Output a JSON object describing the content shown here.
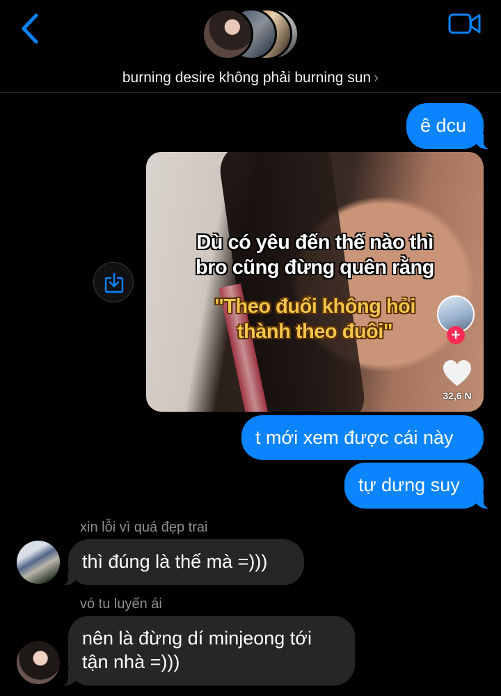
{
  "header": {
    "group_name": "burning desire không phải burning sun",
    "chevron": "›",
    "back_icon": "chevron-left-icon",
    "video_icon": "video-camera-icon",
    "accent_color": "#0a84ff"
  },
  "messages": {
    "out1": "ê dcu",
    "video": {
      "caption_line1": "Dù có yêu đến thế nào thì",
      "caption_line2": "bro cũng đừng quên rằng",
      "caption_quote1": "\"Theo đuổi không hỏi",
      "caption_quote2": "thành theo đuôi\"",
      "likes": "32,6 N",
      "plus": "+"
    },
    "out2": "t mới xem được cái này",
    "out3": "tự dưng suy",
    "in1_sender": "xin lỗi vì quá đẹp trai",
    "in1": "thì đúng là thế mà =)))",
    "in2_sender": "vó tu luyến ái",
    "in2_line1": "nên là đừng dí minjeong tới",
    "in2_line2": "tận nhà =)))"
  },
  "colors": {
    "outgoing_bubble": "#0a84ff",
    "incoming_bubble": "#262628",
    "background": "#000000",
    "secondary_text": "#8e8e93"
  }
}
